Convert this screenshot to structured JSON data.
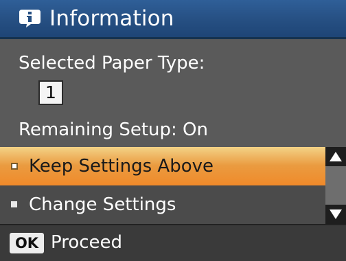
{
  "header": {
    "icon": "info-icon",
    "title": "Information"
  },
  "content": {
    "paper_type_label": "Selected Paper Type:",
    "paper_type_value": "1",
    "remaining_setup": "Remaining Setup: On"
  },
  "menu": {
    "items": [
      {
        "label": "Keep Settings Above",
        "selected": true
      },
      {
        "label": "Change Settings",
        "selected": false
      }
    ]
  },
  "scrollbar": {
    "up_icon": "triangle-up-icon",
    "down_icon": "triangle-down-icon"
  },
  "footer": {
    "button_label": "OK",
    "action_label": "Proceed"
  },
  "colors": {
    "title_bar": "#264f82",
    "selected_item": "#ea9b40",
    "background": "#5a5a5a"
  }
}
